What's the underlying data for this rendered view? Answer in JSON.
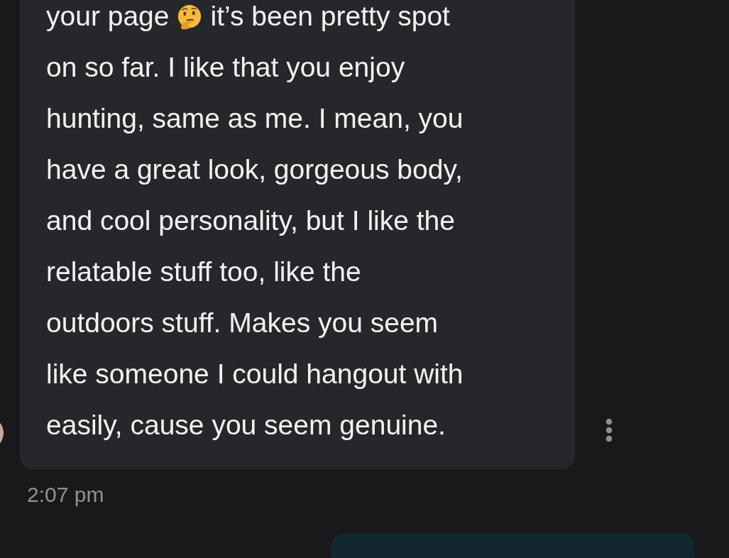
{
  "received_message": {
    "lines": [
      {
        "kind": "with_emoji",
        "text": "your page",
        "rest": "it’s been pretty spot"
      },
      {
        "text": "on so far. I like that you enjoy"
      },
      {
        "text": "hunting, same as me. I mean, you"
      },
      {
        "text": "have a great look, gorgeous body,"
      },
      {
        "text": "and cool personality, but I like the"
      },
      {
        "text": "relatable stuff too, like the"
      },
      {
        "text": "outdoors stuff. Makes you seem"
      },
      {
        "text": "like someone I could hangout with"
      },
      {
        "text": "easily, cause you seem genuine."
      }
    ],
    "time": "2:07 pm"
  },
  "sent_message": {
    "kind": "bubble"
  }
}
